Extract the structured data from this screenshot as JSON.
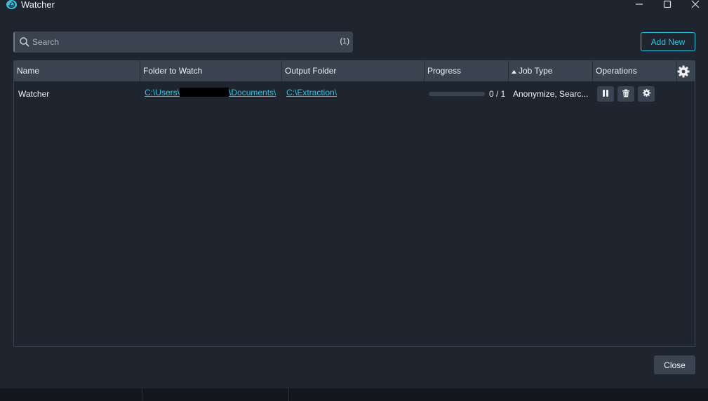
{
  "window": {
    "title": "Watcher",
    "accent_color": "#2ec4e6",
    "logo_icon": "swirl-logo-icon",
    "controls": [
      "minimize-icon",
      "maximize-icon",
      "close-icon"
    ]
  },
  "search": {
    "placeholder": "Search",
    "value": "",
    "count": "(1)"
  },
  "toolbar": {
    "add_new_label": "Add New"
  },
  "table": {
    "columns": {
      "name": "Name",
      "folder": "Folder to Watch",
      "output": "Output Folder",
      "progress": "Progress",
      "job_type": "Job Type",
      "operations": "Operations"
    },
    "sorted_column": "job_type",
    "sort_direction": "ascending",
    "rows": [
      {
        "name": "Watcher",
        "folder_prefix": "C:\\Users\\",
        "folder_suffix": "\\Documents\\",
        "output_folder": "C:\\Extraction\\",
        "progress_fraction": 0,
        "progress_text": "0 / 1",
        "job_type": "Anonymize, Searc...",
        "operations": [
          "pause-icon",
          "trash-icon",
          "gear-icon"
        ]
      }
    ]
  },
  "footer": {
    "close_label": "Close"
  }
}
